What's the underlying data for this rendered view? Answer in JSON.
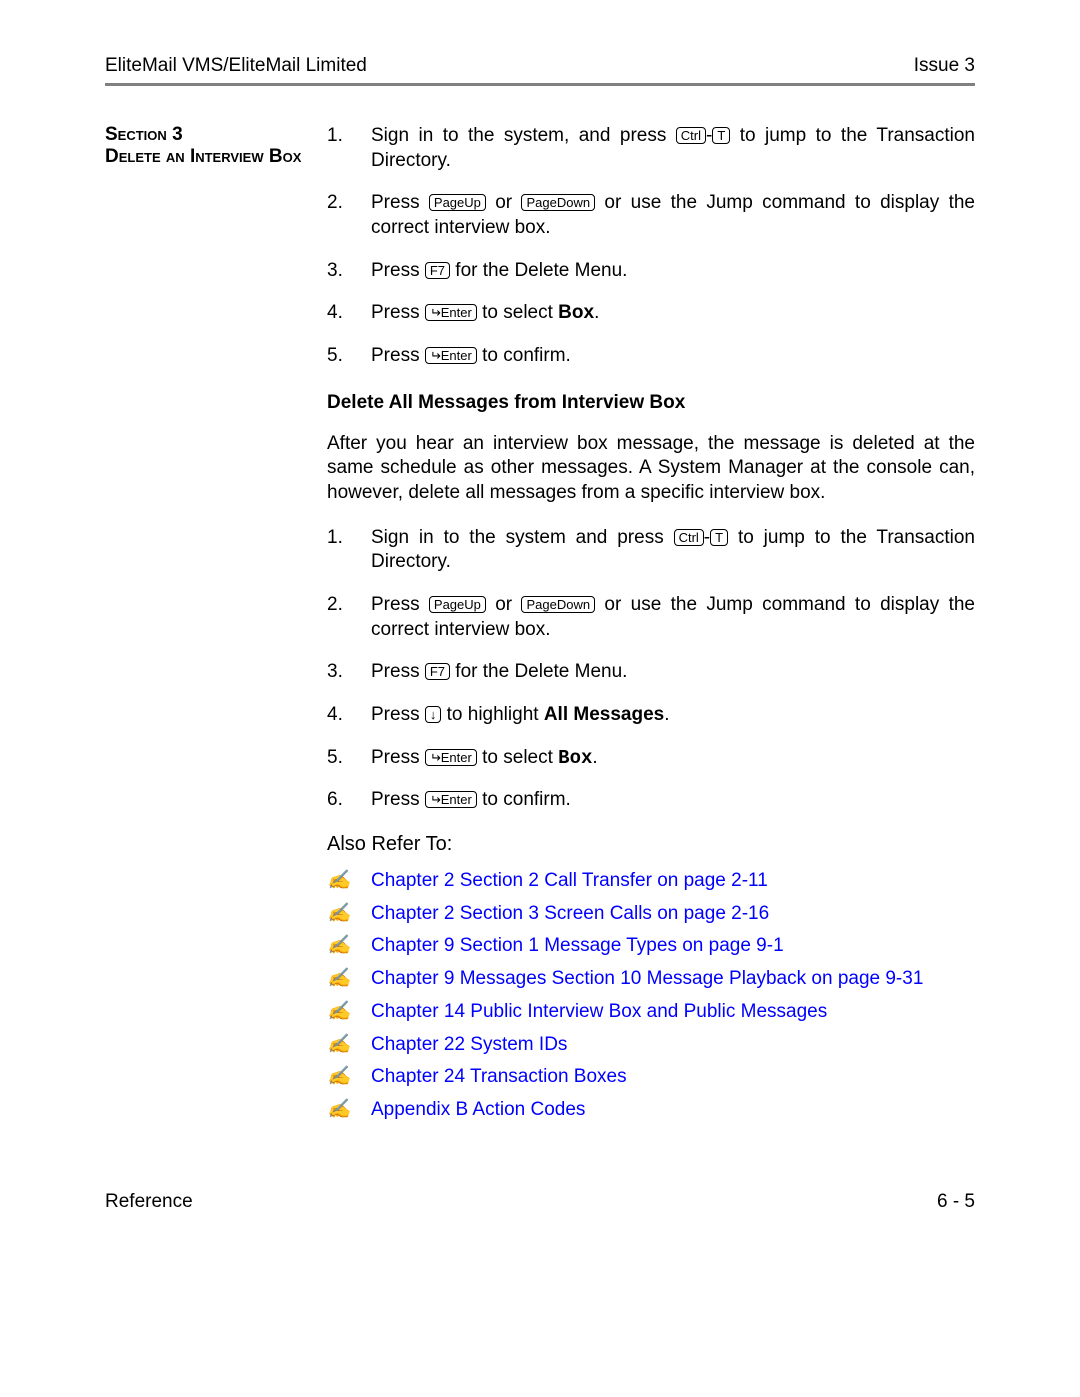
{
  "header": {
    "left": "EliteMail VMS/EliteMail Limited",
    "right": "Issue 3"
  },
  "section": {
    "num": "Section 3",
    "title": "Delete an Interview Box"
  },
  "keys": {
    "ctrl": "Ctrl",
    "t": "T",
    "pageup": "PageUp",
    "pagedown": "PageDown",
    "f7": "F7",
    "enter": "Enter",
    "down": "↓"
  },
  "list1": [
    {
      "n": "1.",
      "a": "Sign in to the system, and press ",
      "b": " to jump to the Transaction Directory."
    },
    {
      "n": "2.",
      "a": "Press ",
      "mid": " or ",
      "b": " or use the Jump command to display the correct interview box."
    },
    {
      "n": "3.",
      "a": "Press ",
      "b": " for the Delete Menu."
    },
    {
      "n": "4.",
      "a": "Press ",
      "b": " to select ",
      "bold": "Box",
      "c": "."
    },
    {
      "n": "5.",
      "a": "Press ",
      "b": " to confirm."
    }
  ],
  "sub1": "Delete All Messages from Interview Box",
  "para1": "After you hear an interview box message, the message is deleted at the same schedule as other messages. A System Manager at the console can, however, delete all messages from a specific interview box.",
  "list2": [
    {
      "n": "1.",
      "a": "Sign in to the system and press ",
      "b": " to jump to the Transaction Directory."
    },
    {
      "n": "2.",
      "a": "Press ",
      "mid": " or ",
      "b": " or use the Jump command to display the correct interview box."
    },
    {
      "n": "3.",
      "a": "Press ",
      "b": " for the Delete Menu."
    },
    {
      "n": "4.",
      "a": "Press ",
      "b": " to highlight ",
      "bold": "All Messages",
      "c": "."
    },
    {
      "n": "5.",
      "a": "Press ",
      "b": " to select ",
      "mono": "Box",
      "c": "."
    },
    {
      "n": "6.",
      "a": "Press ",
      "b": " to confirm."
    }
  ],
  "also": "Also Refer To:",
  "refs": [
    "Chapter 2 Section 2 Call Transfer on page 2-11",
    "Chapter 2 Section 3 Screen Calls on page 2-16",
    "Chapter 9 Section 1 Message Types on page 9-1",
    "Chapter 9 Messages Section 10 Message Playback on page 9-31",
    "Chapter 14 Public Interview Box and Public Messages",
    "Chapter 22 System IDs",
    "Chapter 24 Transaction Boxes",
    "Appendix B Action Codes"
  ],
  "footer": {
    "left": "Reference",
    "right": "6 - 5"
  },
  "bullet_glyph": "✍"
}
